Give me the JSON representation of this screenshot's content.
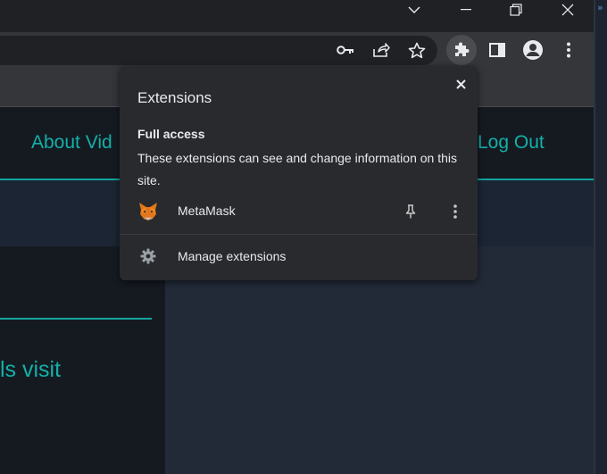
{
  "browser": {
    "window_controls": {
      "tab_search_icon": "chevron-down-icon",
      "minimize_icon": "minimize-icon",
      "restore_icon": "restore-icon",
      "close_icon": "close-icon"
    },
    "toolbar_icons": [
      "key-icon",
      "share-icon",
      "star-icon",
      "extensions-puzzle-icon",
      "side-panel-icon",
      "profile-icon",
      "more-vert-icon"
    ]
  },
  "page": {
    "nav": {
      "about_link": "About Vid",
      "logout_link": "Log Out"
    },
    "left_panel_text": "ls visit"
  },
  "extensions_popup": {
    "title": "Extensions",
    "section_heading": "Full access",
    "section_description": "These extensions can see and change information on this site.",
    "extensions": [
      {
        "name": "MetaMask",
        "icon": "metamask-fox-icon"
      }
    ],
    "manage_label": "Manage extensions"
  },
  "colors": {
    "accent": "#14b0a8",
    "popup_bg": "#292a2d",
    "toolbar_bg": "#35363a"
  }
}
